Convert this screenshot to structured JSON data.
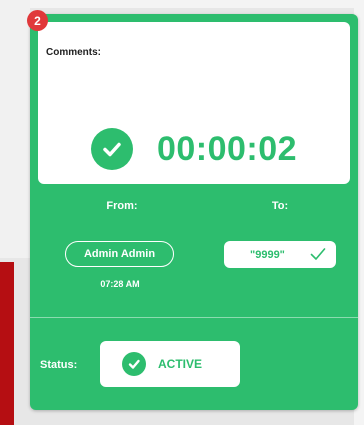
{
  "badge": {
    "count": "2"
  },
  "comments": {
    "label": "Comments:",
    "value": ""
  },
  "timer": {
    "elapsed": "00:00:02"
  },
  "from": {
    "label": "From:",
    "user": "Admin Admin",
    "time": "07:28 AM"
  },
  "to": {
    "label": "To:",
    "value": "\"9999\""
  },
  "status": {
    "label": "Status:",
    "value": "ACTIVE"
  },
  "colors": {
    "card_green": "#2dbd6e",
    "badge_red": "#e0383a",
    "white": "#ffffff",
    "side_red": "#b50e12"
  },
  "icons": {
    "timer": "check-circle-icon",
    "to": "checkmark-icon",
    "status": "check-circle-icon"
  }
}
